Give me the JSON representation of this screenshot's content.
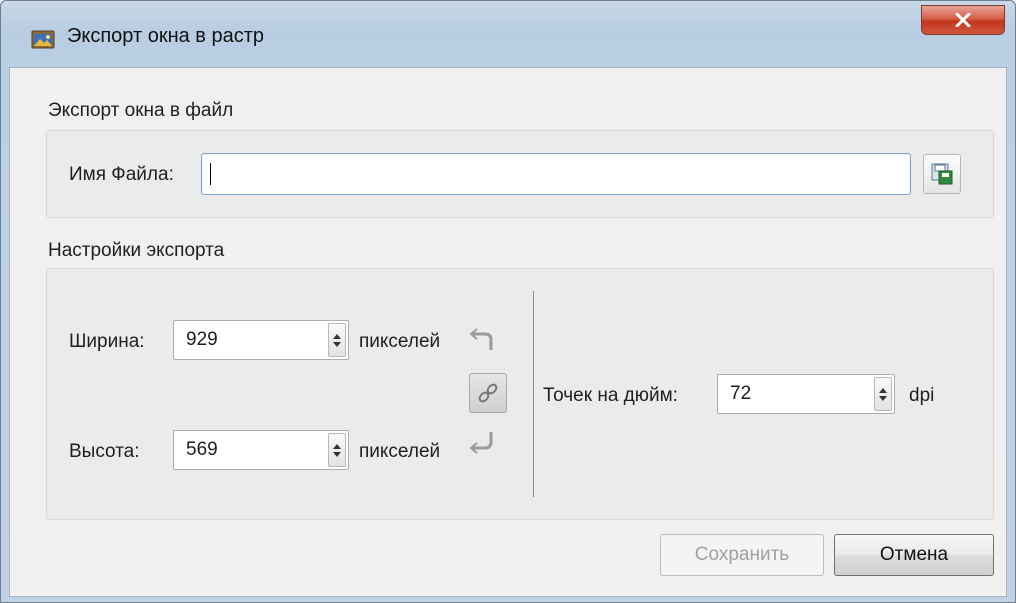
{
  "window": {
    "title": "Экспорт окна в растр",
    "close_icon": "close-x-icon",
    "app_icon": "image-export-icon"
  },
  "file_section": {
    "label": "Экспорт окна в файл",
    "filename_label": "Имя Файла:",
    "filename_value": "",
    "browse_icon": "save-file-icon"
  },
  "settings_section": {
    "label": "Настройки экспорта",
    "width_label": "Ширина:",
    "width_value": "929",
    "width_unit": "пикселей",
    "height_label": "Высота:",
    "height_value": "569",
    "height_unit": "пикселей",
    "link_icon": "chain-link-icon",
    "dpi_label": "Точек на дюйм:",
    "dpi_value": "72",
    "dpi_unit": "dpi"
  },
  "buttons": {
    "save": "Сохранить",
    "cancel": "Отмена"
  },
  "colors": {
    "accent_border": "#7da2ce",
    "close_red": "#c2351d"
  }
}
